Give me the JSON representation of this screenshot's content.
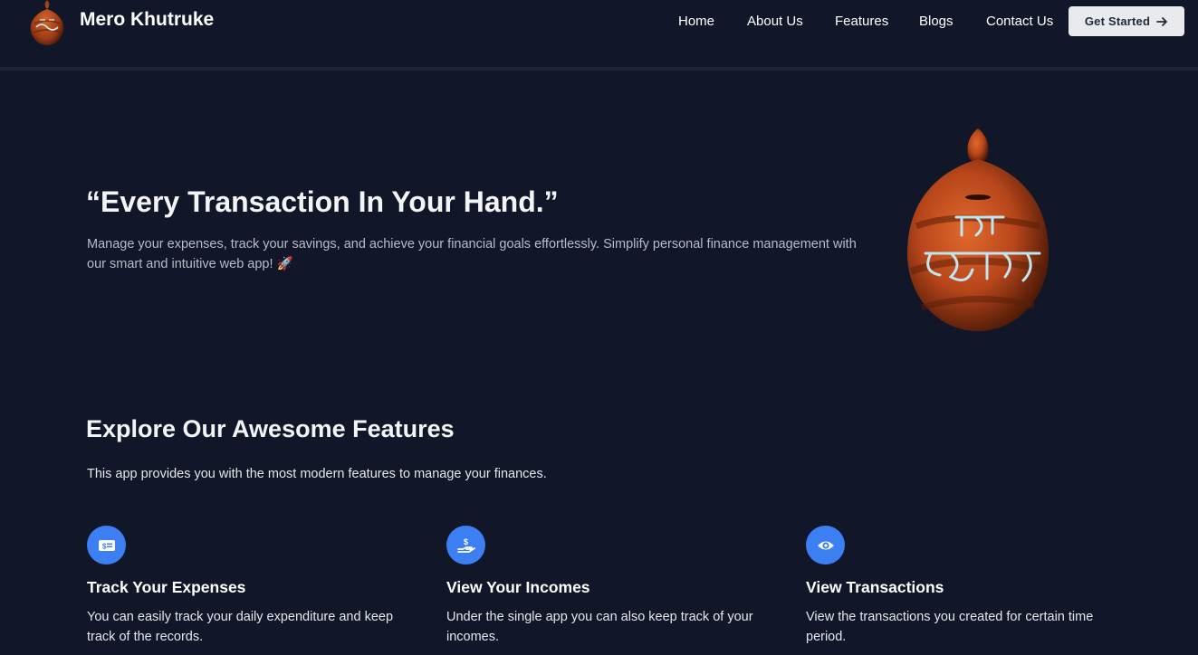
{
  "brand": {
    "name": "Mero Khutruke",
    "logo": "khutruke-pot-logo"
  },
  "nav": {
    "items": [
      {
        "label": "Home"
      },
      {
        "label": "About Us"
      },
      {
        "label": "Features"
      },
      {
        "label": "Blogs"
      },
      {
        "label": "Contact Us"
      }
    ],
    "cta_label": "Get Started",
    "cta_icon": "arrow-right-icon"
  },
  "hero": {
    "title": "“Every Transaction In Your Hand.”",
    "description": "Manage your expenses, track your savings, and achieve your financial goals effortlessly. Simplify personal finance management with our smart and intuitive web app! 🚀",
    "image_text": "मेरो खुत्रुके"
  },
  "features": {
    "title": "Explore Our Awesome Features",
    "subtitle": "This app provides you with the most modern features to manage your finances.",
    "cards": [
      {
        "icon": "money-bill-icon",
        "title": "Track Your Expenses",
        "description": "You can easily track your daily expenditure and keep track of the records."
      },
      {
        "icon": "hand-dollar-icon",
        "title": "View Your Incomes",
        "description": "Under the single app you can also keep track of your incomes."
      },
      {
        "icon": "eye-icon",
        "title": "View Transactions",
        "description": "View the transactions you created for certain time period."
      }
    ]
  },
  "colors": {
    "background": "#111729",
    "accent": "#3b7ff2",
    "button_bg": "#e8eaee",
    "pot": "#b8461b"
  }
}
